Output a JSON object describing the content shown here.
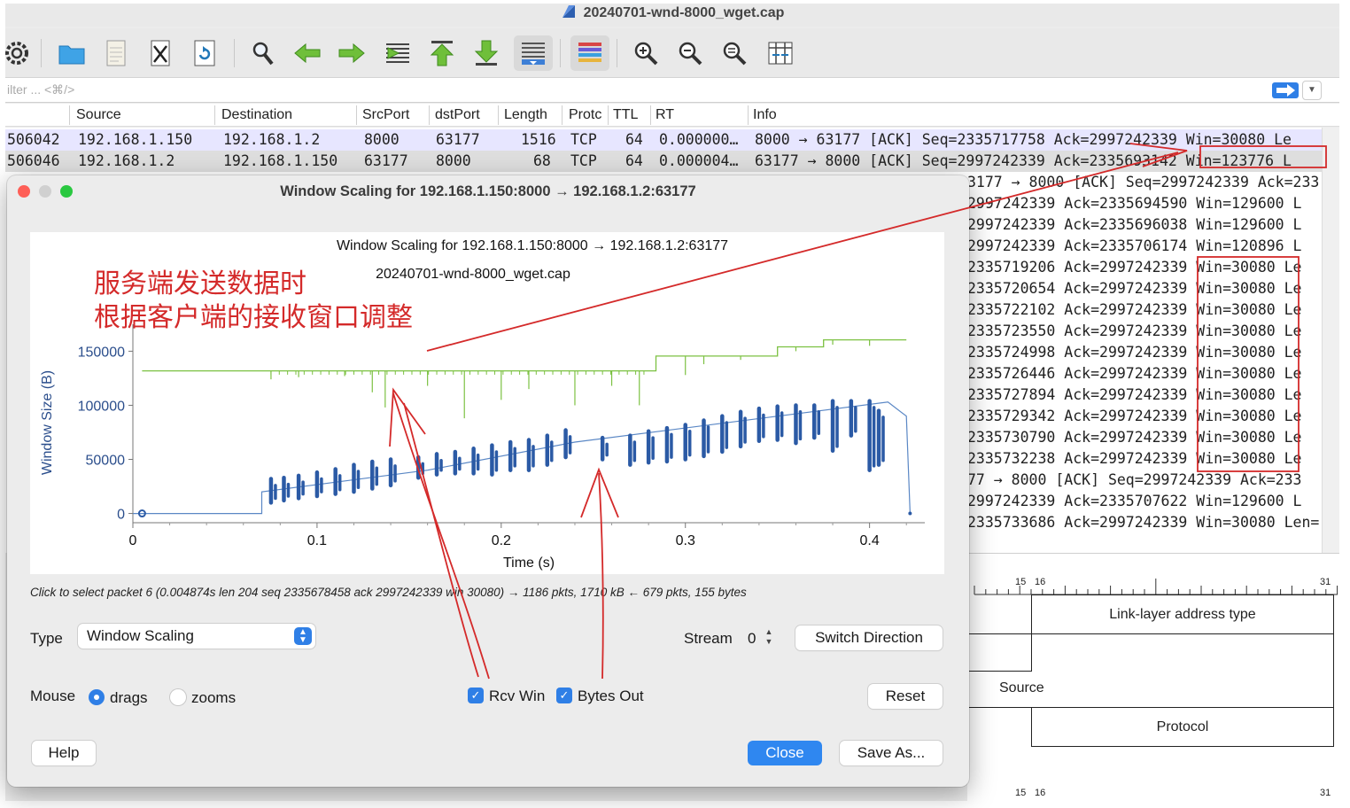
{
  "window": {
    "title": "20240701-wnd-8000_wget.cap"
  },
  "filter": {
    "placeholder": "ilter ... <⌘/>"
  },
  "columns": [
    "Source",
    "Destination",
    "SrcPort",
    "dstPort",
    "Length",
    "Protc",
    "TTL",
    "RT",
    "Info"
  ],
  "packets_full": [
    {
      "no": "506042",
      "src": "192.168.1.150",
      "dst": "192.168.1.2",
      "sport": "8000",
      "dport": "63177",
      "len": "1516",
      "proto": "TCP",
      "ttl": "64",
      "rt": "0.000000…",
      "info": "8000 → 63177 [ACK] Seq=2335717758 Ack=2997242339 Win=30080 Le"
    },
    {
      "no": "506046",
      "src": "192.168.1.2",
      "dst": "192.168.1.150",
      "sport": "63177",
      "dport": "8000",
      "len": "68",
      "proto": "TCP",
      "ttl": "64",
      "rt": "0.000004…",
      "info": "63177 → 8000 [ACK] Seq=2997242339 Ack=2335693142 Win=123776 L"
    }
  ],
  "packets_info": [
    "3177 → 8000 [ACK] Seq=2997242339 Ack=233",
    "2997242339 Ack=2335694590 Win=129600 L",
    "2997242339 Ack=2335696038 Win=129600 L",
    "2997242339 Ack=2335706174 Win=120896 L",
    "2335719206 Ack=2997242339 Win=30080 Le",
    "2335720654 Ack=2997242339 Win=30080 Le",
    "2335722102 Ack=2997242339 Win=30080 Le",
    "2335723550 Ack=2997242339 Win=30080 Le",
    "2335724998 Ack=2997242339 Win=30080 Le",
    "2335726446 Ack=2997242339 Win=30080 Le",
    "2335727894 Ack=2997242339 Win=30080 Le",
    "2335729342 Ack=2997242339 Win=30080 Le",
    "2335730790 Ack=2997242339 Win=30080 Le",
    "2335732238 Ack=2997242339 Win=30080 Le",
    "77 → 8000 [ACK] Seq=2997242339 Ack=233",
    "2997242339 Ack=2335707622 Win=129600 L",
    "2335733686 Ack=2997242339 Win=30080 Len="
  ],
  "detail": {
    "ruler": [
      "15",
      "16",
      "31"
    ],
    "fields": [
      "Link-layer address type",
      "Source",
      "Protocol"
    ]
  },
  "dialog": {
    "title": "Window Scaling for 192.168.1.150:8000 → 192.168.1.2:63177",
    "hint": "Click to select packet 6 (0.004874s len 204 seq 2335678458 ack 2997242339 win 30080) → 1186 pkts, 1710 kB ← 679 pkts, 155 bytes",
    "type_label": "Type",
    "type_value": "Window Scaling",
    "stream_label": "Stream",
    "stream_value": "0",
    "switch_direction": "Switch Direction",
    "mouse_label": "Mouse",
    "mouse_drags": "drags",
    "mouse_zooms": "zooms",
    "rcv_win": "Rcv Win",
    "bytes_out": "Bytes Out",
    "reset": "Reset",
    "help": "Help",
    "close": "Close",
    "save_as": "Save As..."
  },
  "annotation": {
    "line1": "服务端发送数据时",
    "line2": "根据客户端的接收窗口调整",
    "color": "#d42a2a"
  },
  "chart_data": {
    "type": "line",
    "title": "Window Scaling for 192.168.1.150:8000 → 192.168.1.2:63177",
    "subtitle": "20240701-wnd-8000_wget.cap",
    "xlabel": "Time (s)",
    "ylabel": "Window Size (B)",
    "xlim": [
      0,
      0.43
    ],
    "ylim": [
      -2000,
      170000
    ],
    "xticks": [
      0,
      0.1,
      0.2,
      0.3,
      0.4
    ],
    "xtick_labels": [
      "0",
      "0.1",
      "0.2",
      "0.3",
      "0.4"
    ],
    "yticks": [
      0,
      50000,
      100000,
      150000
    ],
    "ytick_labels": [
      "0",
      "50000",
      "100000",
      "150000"
    ],
    "series": [
      {
        "name": "Rcv Win",
        "color": "#7cc142",
        "steps": [
          [
            0.005,
            131800
          ],
          [
            0.284,
            131800
          ],
          [
            0.284,
            145500
          ],
          [
            0.35,
            145500
          ],
          [
            0.35,
            154000
          ],
          [
            0.375,
            154000
          ],
          [
            0.375,
            160500
          ],
          [
            0.42,
            160500
          ]
        ],
        "dips": [
          [
            0.075,
            124000
          ],
          [
            0.09,
            126000
          ],
          [
            0.115,
            127000
          ],
          [
            0.13,
            112000
          ],
          [
            0.137,
            98000
          ],
          [
            0.16,
            118000
          ],
          [
            0.18,
            88000
          ],
          [
            0.2,
            105000
          ],
          [
            0.215,
            115000
          ],
          [
            0.24,
            100000
          ],
          [
            0.26,
            118000
          ],
          [
            0.275,
            100000
          ],
          [
            0.3,
            128000
          ],
          [
            0.31,
            138000
          ],
          [
            0.33,
            142000
          ],
          [
            0.36,
            150000
          ],
          [
            0.38,
            156000
          ],
          [
            0.4,
            155000
          ]
        ]
      },
      {
        "name": "Bytes Out",
        "color": "#2b5aa5",
        "baseline": [
          [
            0,
            0
          ],
          [
            0.07,
            0
          ],
          [
            0.07,
            20000
          ],
          [
            0.16,
            40000
          ],
          [
            0.24,
            66000
          ],
          [
            0.41,
            103000
          ],
          [
            0.42,
            90000
          ],
          [
            0.422,
            0
          ]
        ],
        "bursts": [
          [
            0.075,
            10000,
            32000
          ],
          [
            0.082,
            12000,
            33000
          ],
          [
            0.09,
            14000,
            35000
          ],
          [
            0.1,
            16000,
            38000
          ],
          [
            0.11,
            18000,
            41000
          ],
          [
            0.12,
            20000,
            45000
          ],
          [
            0.13,
            23000,
            48000
          ],
          [
            0.14,
            26000,
            50000
          ],
          [
            0.155,
            33000,
            52000
          ],
          [
            0.165,
            36000,
            55000
          ],
          [
            0.175,
            37000,
            57000
          ],
          [
            0.185,
            37000,
            60000
          ],
          [
            0.195,
            36000,
            63000
          ],
          [
            0.205,
            40000,
            66000
          ],
          [
            0.215,
            40000,
            68000
          ],
          [
            0.225,
            45000,
            72000
          ],
          [
            0.235,
            52000,
            77000
          ],
          [
            0.255,
            50000,
            70000
          ],
          [
            0.27,
            45000,
            72000
          ],
          [
            0.28,
            47000,
            76000
          ],
          [
            0.29,
            48000,
            79000
          ],
          [
            0.3,
            50000,
            82000
          ],
          [
            0.31,
            53000,
            86000
          ],
          [
            0.32,
            57000,
            90000
          ],
          [
            0.33,
            62000,
            94000
          ],
          [
            0.34,
            67000,
            97000
          ],
          [
            0.35,
            68000,
            99000
          ],
          [
            0.36,
            65000,
            100000
          ],
          [
            0.37,
            70000,
            100000
          ],
          [
            0.38,
            58000,
            104000
          ],
          [
            0.39,
            72000,
            104000
          ],
          [
            0.4,
            40000,
            104000
          ],
          [
            0.405,
            45000,
            95000
          ]
        ]
      }
    ]
  }
}
